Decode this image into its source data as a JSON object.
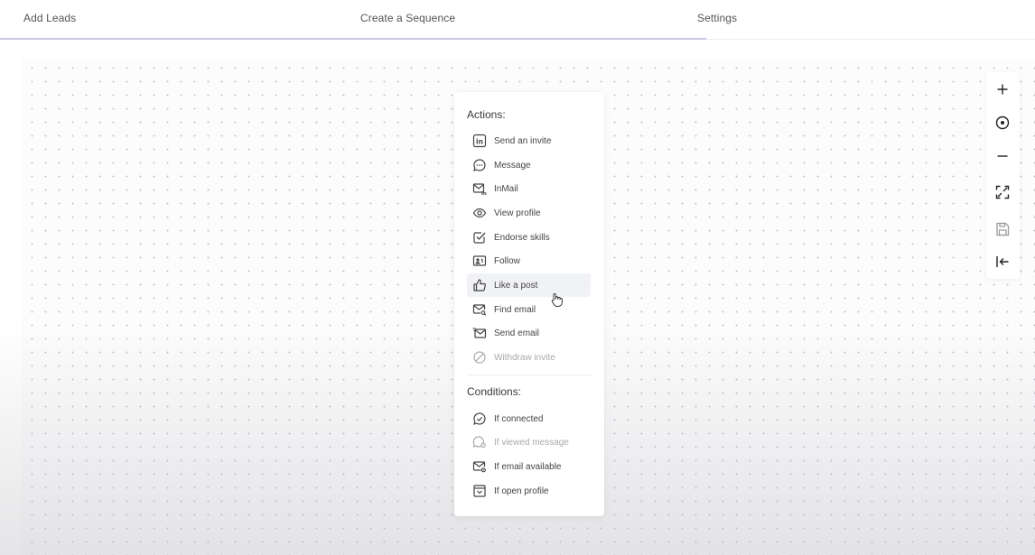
{
  "tabs": [
    {
      "label": "Add Leads"
    },
    {
      "label": "Create a Sequence"
    },
    {
      "label": "Settings"
    }
  ],
  "menu": {
    "actions_title": "Actions:",
    "conditions_title": "Conditions:",
    "actions": [
      {
        "label": "Send an invite",
        "icon": "linkedin-icon"
      },
      {
        "label": "Message",
        "icon": "chat-bubble-icon"
      },
      {
        "label": "InMail",
        "icon": "inmail-icon"
      },
      {
        "label": "View profile",
        "icon": "eye-icon"
      },
      {
        "label": "Endorse skills",
        "icon": "checkbox-icon"
      },
      {
        "label": "Follow",
        "icon": "follow-icon"
      },
      {
        "label": "Like a post",
        "icon": "thumbs-up-icon"
      },
      {
        "label": "Find email",
        "icon": "find-email-icon"
      },
      {
        "label": "Send email",
        "icon": "send-email-icon"
      },
      {
        "label": "Withdraw invite",
        "icon": "withdraw-icon"
      }
    ],
    "conditions": [
      {
        "label": "If connected",
        "icon": "connected-icon"
      },
      {
        "label": "If viewed message",
        "icon": "viewed-message-icon"
      },
      {
        "label": "If email available",
        "icon": "email-available-icon"
      },
      {
        "label": "If open profile",
        "icon": "open-profile-icon"
      }
    ]
  },
  "toolbar": [
    {
      "name": "zoom-in",
      "icon": "plus-icon"
    },
    {
      "name": "center",
      "icon": "target-icon"
    },
    {
      "name": "zoom-out",
      "icon": "minus-icon"
    },
    {
      "name": "fit-view",
      "icon": "expand-icon"
    },
    {
      "name": "save",
      "icon": "save-icon"
    },
    {
      "name": "exit",
      "icon": "exit-icon"
    }
  ]
}
